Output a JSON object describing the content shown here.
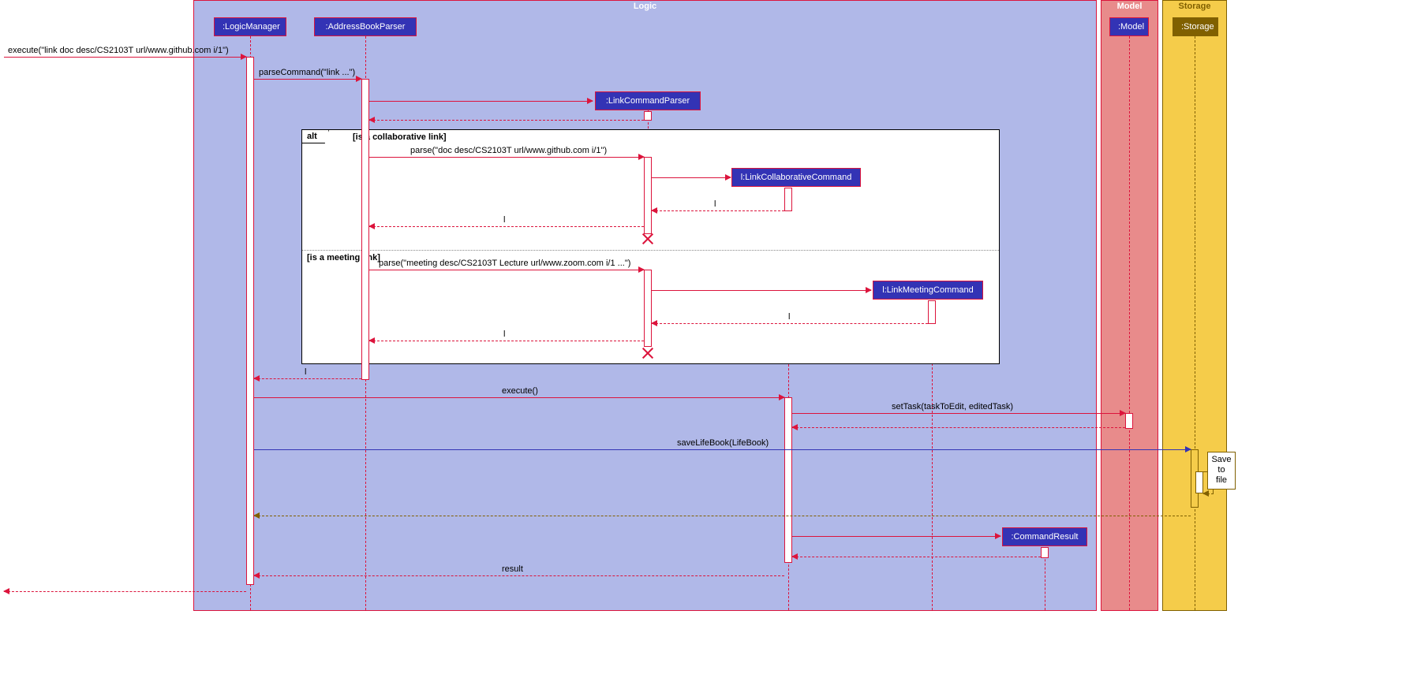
{
  "frames": {
    "logic": "Logic",
    "model": "Model",
    "storage": "Storage"
  },
  "participants": {
    "logicManager": ":LogicManager",
    "addressBookParser": ":AddressBookParser",
    "linkCommandParser": ":LinkCommandParser",
    "linkCollaborativeCommand": "l:LinkCollaborativeCommand",
    "linkMeetingCommand": "l:LinkMeetingCommand",
    "commandResult": ":CommandResult",
    "model": ":Model",
    "storage": ":Storage"
  },
  "alt": {
    "label": "alt",
    "guard1": "[is a collaborative link]",
    "guard2": "[is a meeting link]"
  },
  "messages": {
    "executeEntry": "execute(\"link doc desc/CS2103T url/www.github.com i/1\")",
    "parseCommand": "parseCommand(\"link ...\")",
    "parse1": "parse(\"doc desc/CS2103T url/www.github.com i/1\")",
    "parse2": "parse(\"meeting desc/CS2103T Lecture url/www.zoom.com i/1 ...\")",
    "returnL1": "l",
    "returnL2": "l",
    "returnL3": "l",
    "returnL4": "l",
    "execute": "execute()",
    "setTask": "setTask(taskToEdit, editedTask)",
    "saveLifeBook": "saveLifeBook(LifeBook)",
    "result": "result"
  },
  "note": {
    "saveToFile": "Save\nto file"
  }
}
